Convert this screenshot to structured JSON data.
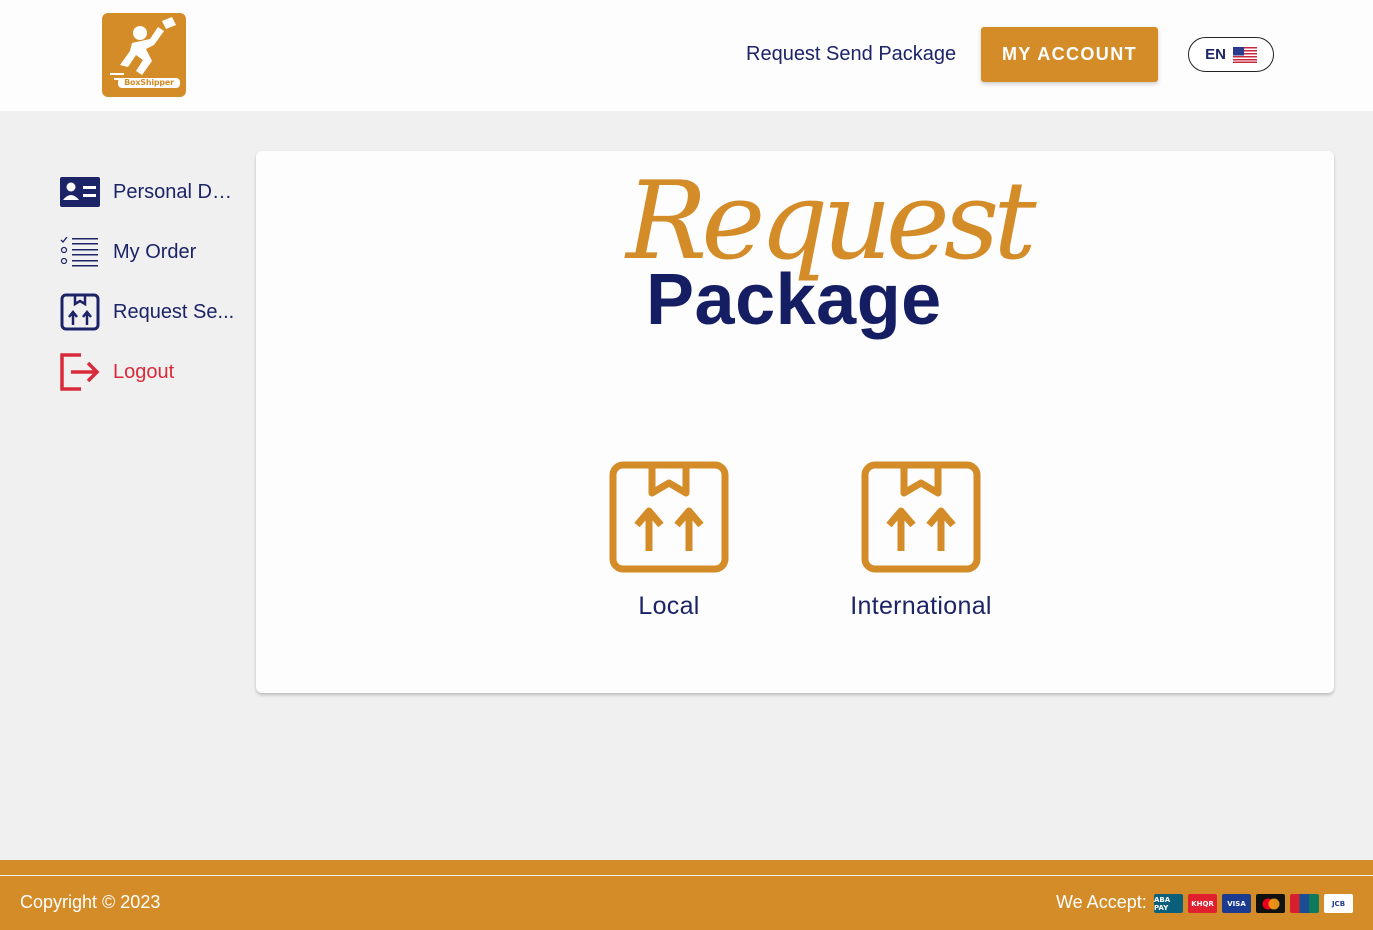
{
  "header": {
    "logo_text": "BoxShipper",
    "nav_link": "Request Send Package",
    "account_button": "MY ACCOUNT",
    "language": "EN",
    "flag_icon": "us-flag-icon"
  },
  "sidebar": {
    "items": [
      {
        "label": "Personal De...",
        "icon": "id-card-icon"
      },
      {
        "label": "My Order",
        "icon": "checklist-icon"
      },
      {
        "label": "Request Se...",
        "icon": "package-icon"
      },
      {
        "label": "Logout",
        "icon": "logout-icon"
      }
    ]
  },
  "main": {
    "title_script": "Request",
    "title_main": "Package",
    "options": [
      {
        "label": "Local",
        "icon": "package-icon"
      },
      {
        "label": "International",
        "icon": "package-icon"
      }
    ]
  },
  "footer": {
    "copyright": "Copyright © 2023",
    "accept_label": "We Accept:",
    "payment_methods": [
      "ABA PAY",
      "KHQR",
      "VISA",
      "Mastercard",
      "UnionPay",
      "JCB"
    ]
  },
  "colors": {
    "brand": "#d48c28",
    "navy": "#1c2366",
    "logout_red": "#d92a3a"
  }
}
